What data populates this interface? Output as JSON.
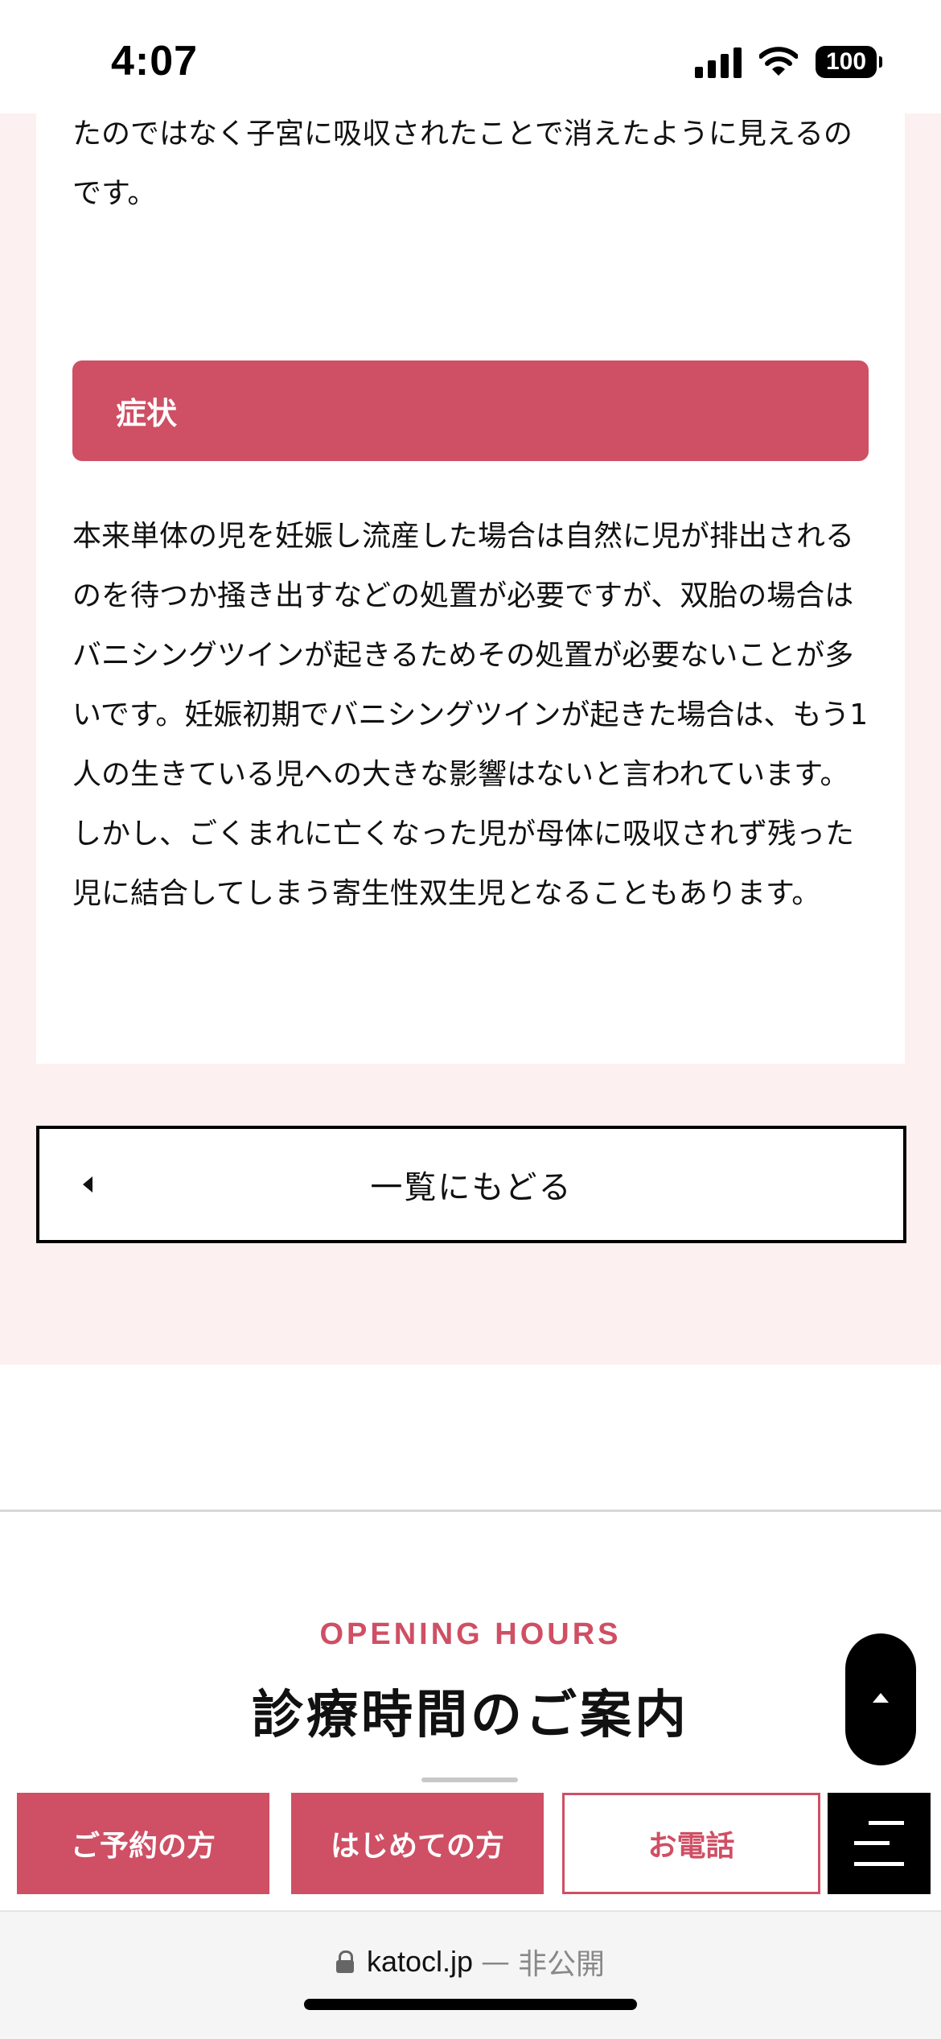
{
  "status_bar": {
    "time": "4:07",
    "battery": "100"
  },
  "article": {
    "top_text": "たのではなく子宮に吸収されたことで消えたように見えるのです。",
    "section_heading": "症状",
    "body_text": "本来単体の児を妊娠し流産した場合は自然に児が排出されるのを待つか掻き出すなどの処置が必要ですが、双胎の場合はバニシングツインが起きるためその処置が必要ないことが多いです。妊娠初期でバニシングツインが起きた場合は、もう1人の生きている児への大きな影響はないと言われています。しかし、ごくまれに亡くなった児が母体に吸収されず残った児に結合してしまう寄生性双生児となることもあります。"
  },
  "back_button": {
    "label": "一覧にもどる"
  },
  "opening_hours": {
    "eyebrow": "OPENING HOURS",
    "title": "診療時間のご案内"
  },
  "bottom_bar": {
    "reservation": "ご予約の方",
    "first_visit": "はじめての方",
    "phone": "お電話"
  },
  "browser": {
    "host": "katocl.jp",
    "separator": "—",
    "note": "非公開"
  },
  "colors": {
    "accent": "#cf4f64",
    "pink_bg": "#fcf0f1"
  }
}
